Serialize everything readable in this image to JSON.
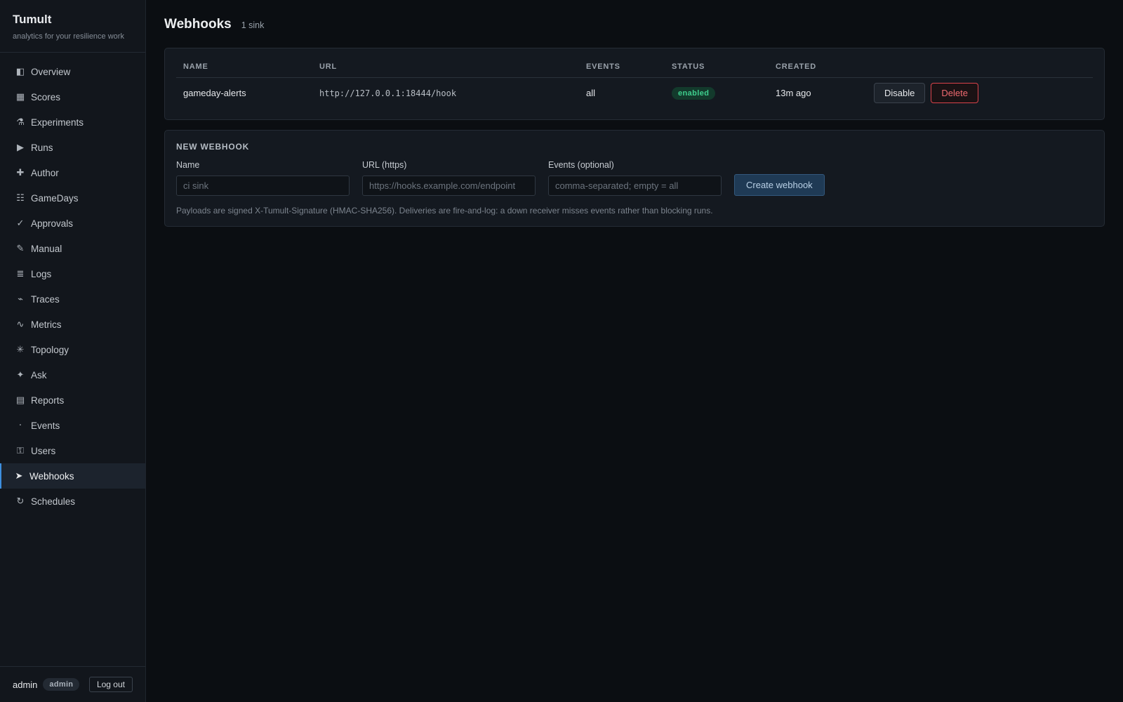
{
  "brand": {
    "name": "Tumult",
    "tagline": "analytics for your resilience work"
  },
  "sidebar": {
    "items": [
      {
        "label": "Overview",
        "icon": "◧",
        "icon_name": "overview-icon"
      },
      {
        "label": "Scores",
        "icon": "▦",
        "icon_name": "scores-icon"
      },
      {
        "label": "Experiments",
        "icon": "⚗",
        "icon_name": "flask-icon"
      },
      {
        "label": "Runs",
        "icon": "▶",
        "icon_name": "play-icon"
      },
      {
        "label": "Author",
        "icon": "✚",
        "icon_name": "plus-icon"
      },
      {
        "label": "GameDays",
        "icon": "☷",
        "icon_name": "calendar-icon"
      },
      {
        "label": "Approvals",
        "icon": "✓",
        "icon_name": "check-icon"
      },
      {
        "label": "Manual",
        "icon": "✎",
        "icon_name": "pencil-icon"
      },
      {
        "label": "Logs",
        "icon": "≣",
        "icon_name": "lines-icon"
      },
      {
        "label": "Traces",
        "icon": "⌁",
        "icon_name": "trace-icon"
      },
      {
        "label": "Metrics",
        "icon": "∿",
        "icon_name": "wave-icon"
      },
      {
        "label": "Topology",
        "icon": "✳",
        "icon_name": "topology-icon"
      },
      {
        "label": "Ask",
        "icon": "✦",
        "icon_name": "sparkle-icon"
      },
      {
        "label": "Reports",
        "icon": "▤",
        "icon_name": "report-icon"
      },
      {
        "label": "Events",
        "icon": "‧",
        "icon_name": "dot-icon"
      },
      {
        "label": "Users",
        "icon": "⚿",
        "icon_name": "key-icon"
      },
      {
        "label": "Webhooks",
        "icon": "➤",
        "icon_name": "arrow-icon"
      },
      {
        "label": "Schedules",
        "icon": "↻",
        "icon_name": "refresh-icon"
      }
    ],
    "active_index": 16
  },
  "footer": {
    "user": "admin",
    "role": "admin",
    "logout_label": "Log out"
  },
  "page": {
    "title": "Webhooks",
    "count": "1 sink"
  },
  "table": {
    "headers": {
      "name": "NAME",
      "url": "URL",
      "events": "EVENTS",
      "status": "STATUS",
      "created": "CREATED"
    },
    "rows": [
      {
        "name": "gameday-alerts",
        "url": "http://127.0.0.1:18444/hook",
        "events": "all",
        "status": "enabled",
        "created": "13m ago",
        "disable_label": "Disable",
        "delete_label": "Delete"
      }
    ]
  },
  "form": {
    "heading": "NEW WEBHOOK",
    "name_label": "Name",
    "name_placeholder": "ci sink",
    "url_label": "URL (https)",
    "url_placeholder": "https://hooks.example.com/endpoint",
    "events_label": "Events (optional)",
    "events_placeholder": "comma-separated; empty = all",
    "submit_label": "Create webhook",
    "hint": "Payloads are signed X-Tumult-Signature (HMAC-SHA256). Deliveries are fire-and-log: a down receiver misses events rather than blocking runs."
  },
  "colors": {
    "accent": "#3d8fe0",
    "status_enabled": "#3fcf8e",
    "danger": "#d9434a"
  }
}
